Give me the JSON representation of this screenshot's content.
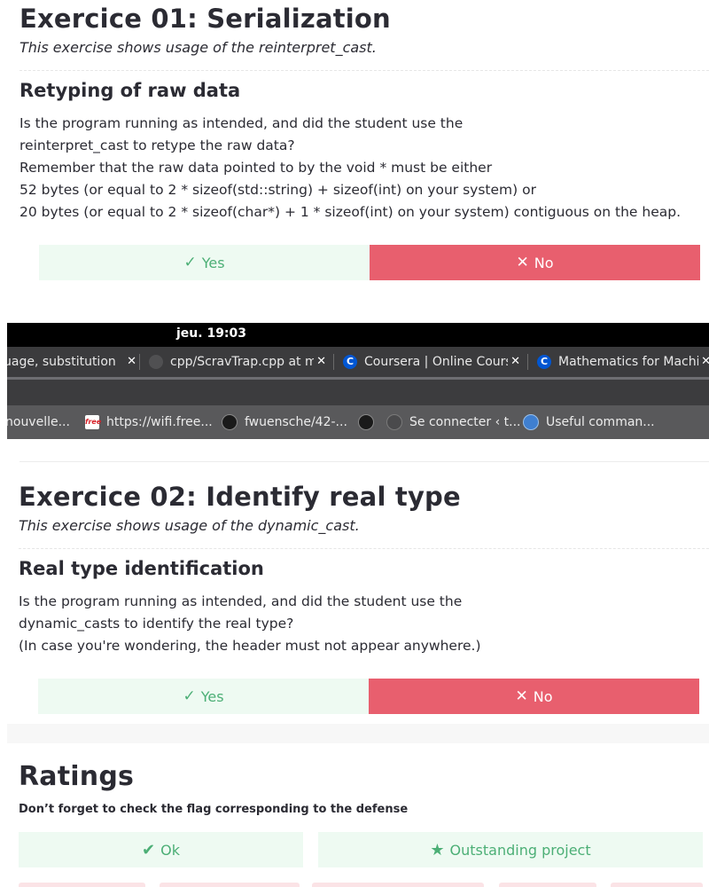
{
  "ex01": {
    "title": "Exercice 01: Serialization",
    "subtitle": "This exercise shows usage of the reinterpret_cast.",
    "section_title": "Retyping of raw data",
    "lines": [
      "Is the program running as intended, and did the student use the",
      "reinterpret_cast to retype the raw data?",
      "Remember that the raw data pointed to by the void * must be either",
      "52 bytes (or equal to 2 * sizeof(std::string) + sizeof(int) on your system) or",
      "20 bytes (or equal to 2 * sizeof(char*) + 1 * sizeof(int) on your system) contiguous on the heap."
    ],
    "yes_label": "Yes",
    "no_label": "No"
  },
  "browser": {
    "clock": "jeu. 19:03",
    "tabs": [
      {
        "label": "uage, substitution",
        "icon": "page-icon"
      },
      {
        "label": "cpp/ScravTrap.cpp at ma",
        "icon": "github-icon"
      },
      {
        "label": "Coursera | Online Cours",
        "icon": "coursera-icon"
      },
      {
        "label": "Mathematics for Machin",
        "icon": "coursera-icon"
      }
    ],
    "close_glyph": "✕",
    "bookmarks": [
      {
        "label": "nouvelle...",
        "icon": "folder-icon"
      },
      {
        "label": "https://wifi.free...",
        "icon": "free-icon"
      },
      {
        "label": "fwuensche/42-...",
        "icon": "github-icon"
      },
      {
        "label": "",
        "icon": "github-icon"
      },
      {
        "label": "Se connecter ‹ t...",
        "icon": "wordpress-icon"
      },
      {
        "label": "Useful comman...",
        "icon": "globe-icon"
      }
    ],
    "colors": {
      "topbar": "#000000",
      "tabbar": "#3b3b3d",
      "bookmarks": "#59595b",
      "coursera": "#0056d2"
    }
  },
  "ex02": {
    "title": "Exercice 02: Identify real type",
    "subtitle": "This exercise shows usage of the dynamic_cast.",
    "section_title": "Real type identification",
    "lines": [
      "Is the program running as intended, and did the student use the",
      "dynamic_casts to identify the real type?",
      "(In case you're wondering, the header must not appear anywhere.)"
    ],
    "yes_label": "Yes",
    "no_label": "No"
  },
  "ratings": {
    "title": "Ratings",
    "note": "Don’t forget to check the flag corresponding to the defense",
    "ok_label": "Ok",
    "outstanding_label": "Outstanding project"
  },
  "colors": {
    "yes_bg": "#eefaf2",
    "yes_fg": "#4caf76",
    "no_bg": "#e85f6e"
  }
}
